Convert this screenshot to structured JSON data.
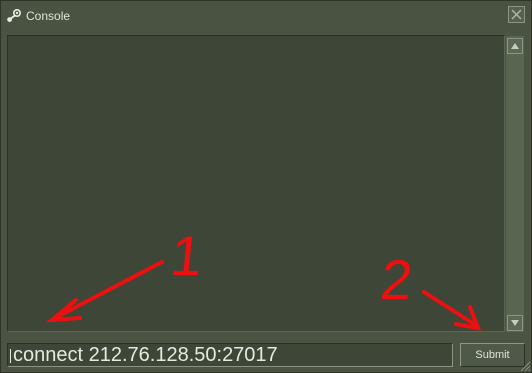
{
  "window": {
    "title": "Console",
    "icon": "steam-icon",
    "close_icon": "close-icon"
  },
  "console_input": {
    "value": "connect 212.76.128.50:27017",
    "placeholder": ""
  },
  "submit": {
    "label": "Submit"
  },
  "annotations": {
    "marker_1": "1",
    "marker_2": "2",
    "color": "#ee1010"
  },
  "colors": {
    "window_bg": "#4b5443",
    "log_bg": "#3e4637",
    "text": "#dfe4d8"
  }
}
